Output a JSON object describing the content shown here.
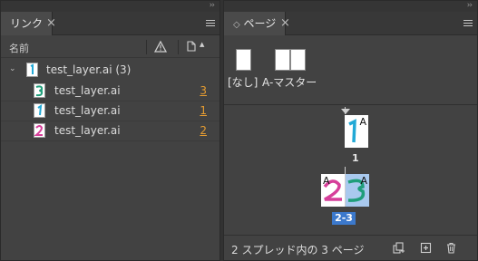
{
  "links_panel": {
    "tab_label": "リンク",
    "tab_close": "×",
    "column_name": "名前",
    "group": {
      "label": "test_layer.ai (3)"
    },
    "items": [
      {
        "label": "test_layer.ai",
        "page": "3",
        "thumb_color": "#1f9e7a",
        "thumb_digit": "3"
      },
      {
        "label": "test_layer.ai",
        "page": "1",
        "thumb_color": "#22a9d6",
        "thumb_digit": "1"
      },
      {
        "label": "test_layer.ai",
        "page": "2",
        "thumb_color": "#d63f9a",
        "thumb_digit": "2"
      }
    ]
  },
  "pages_panel": {
    "tab_label": "ページ",
    "tab_close": "×",
    "tab_prefix": "◇",
    "masters": {
      "none_label": "[なし]",
      "master_label": "A-マスター"
    },
    "page1": {
      "master_letter": "A",
      "number": "1"
    },
    "spread": {
      "left_letter": "A",
      "right_letter": "A",
      "label": "2-3"
    },
    "footer_text": "2 スプレッド内の 3 ページ"
  },
  "colors": {
    "accent": "#e59c32",
    "selection": "#3c79cc",
    "panel_bg": "#424242"
  },
  "icons": [
    "chevron-down-icon",
    "warning-icon",
    "page-icon",
    "menu-icon",
    "new-master-icon",
    "new-page-icon",
    "trash-icon"
  ]
}
